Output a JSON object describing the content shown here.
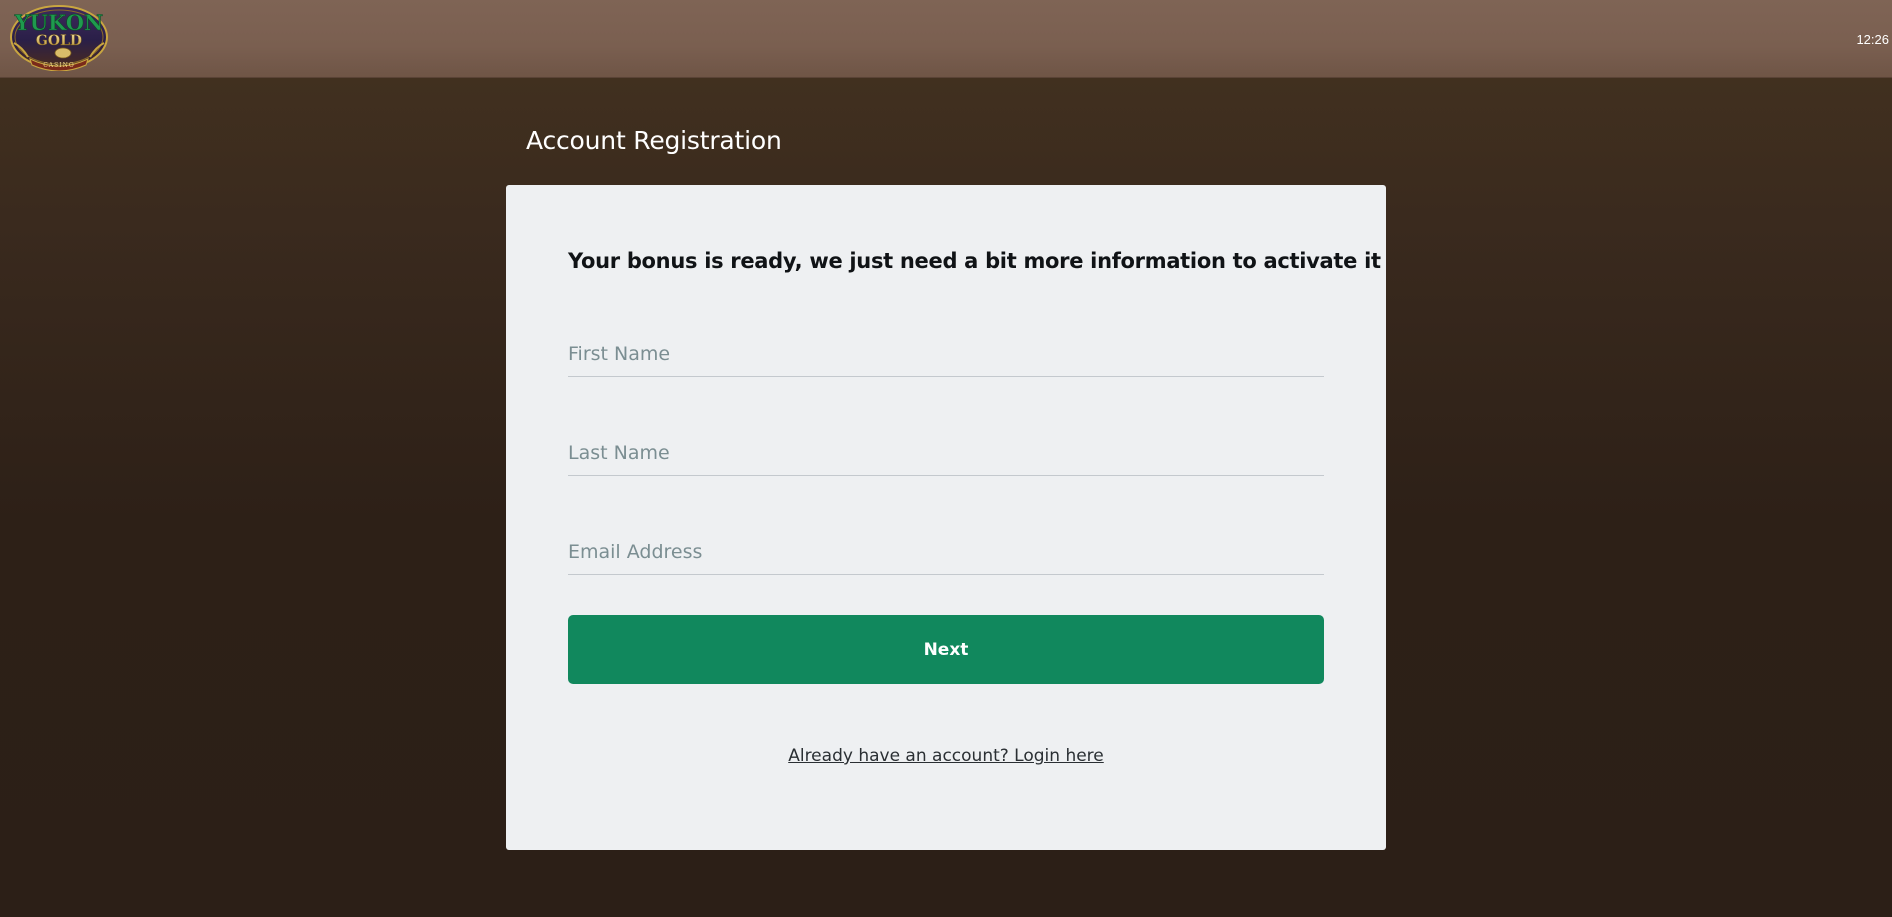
{
  "header": {
    "logo": {
      "word_top": "YUKON",
      "word_mid": "GOLD",
      "word_bottom": "CASINO"
    },
    "clock": "12:26"
  },
  "page": {
    "title": "Account Registration"
  },
  "form": {
    "headline": "Your bonus is ready, we just need a bit more information to activate it",
    "first_name": {
      "placeholder": "First Name",
      "value": ""
    },
    "last_name": {
      "placeholder": "Last Name",
      "value": ""
    },
    "email": {
      "placeholder": "Email Address",
      "value": ""
    },
    "next_label": "Next",
    "login_link": "Already have an account? Login here"
  },
  "colors": {
    "header_bg": "#7a5f50",
    "page_bg": "#2c1f17",
    "card_bg": "#eef0f2",
    "button_green": "#11885d",
    "logo_green": "#1a8a4a",
    "logo_gold": "#c9a640"
  }
}
